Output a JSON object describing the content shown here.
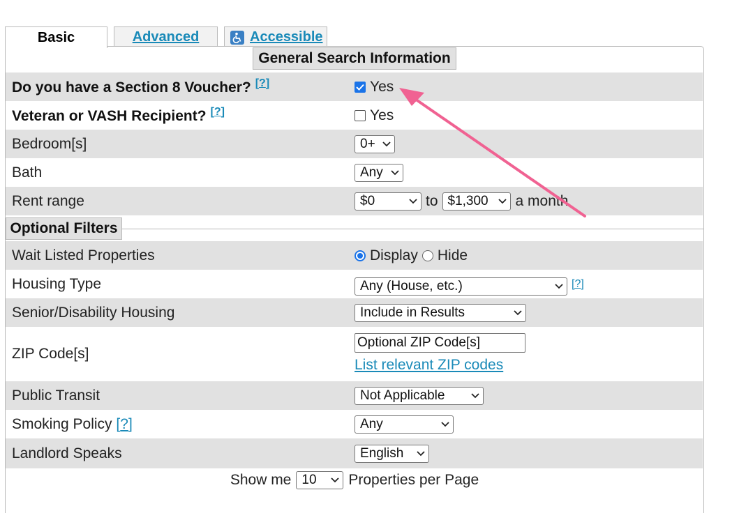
{
  "tabs": {
    "basic": "Basic",
    "advanced": "Advanced",
    "accessible": "Accessible"
  },
  "sections": {
    "general": "General Search Information",
    "optional": "Optional Filters"
  },
  "help_marker": "?",
  "general": {
    "section8": {
      "label": "Do you have a Section 8 Voucher?",
      "option": "Yes",
      "checked": true
    },
    "veteran": {
      "label": "Veteran or VASH Recipient?",
      "option": "Yes",
      "checked": false
    },
    "bedrooms": {
      "label": "Bedroom[s]",
      "value": "0+"
    },
    "bath": {
      "label": "Bath",
      "value": "Any"
    },
    "rent": {
      "label": "Rent range",
      "min": "$0",
      "to": "to",
      "max": "$1,300",
      "suffix": "a month"
    }
  },
  "optional": {
    "waitlisted": {
      "label": "Wait Listed Properties",
      "display": "Display",
      "hide": "Hide",
      "selected": "Display"
    },
    "housing_type": {
      "label": "Housing Type",
      "value": "Any (House, etc.)"
    },
    "senior": {
      "label": "Senior/Disability Housing",
      "value": "Include in Results"
    },
    "zip": {
      "label": "ZIP Code[s]",
      "placeholder": "Optional ZIP Code[s]",
      "link": "List relevant ZIP codes"
    },
    "transit": {
      "label": "Public Transit",
      "value": "Not Applicable"
    },
    "smoking": {
      "label": "Smoking Policy",
      "value": "Any"
    },
    "landlord": {
      "label": "Landlord Speaks",
      "value": "English"
    }
  },
  "footer": {
    "prefix": "Show me",
    "value": "10",
    "suffix": "Properties per Page"
  },
  "colors": {
    "link": "#1a8ab8",
    "stripe": "#e1e1e1",
    "annotation_arrow": "#f06292",
    "checkbox": "#1a73e8"
  }
}
